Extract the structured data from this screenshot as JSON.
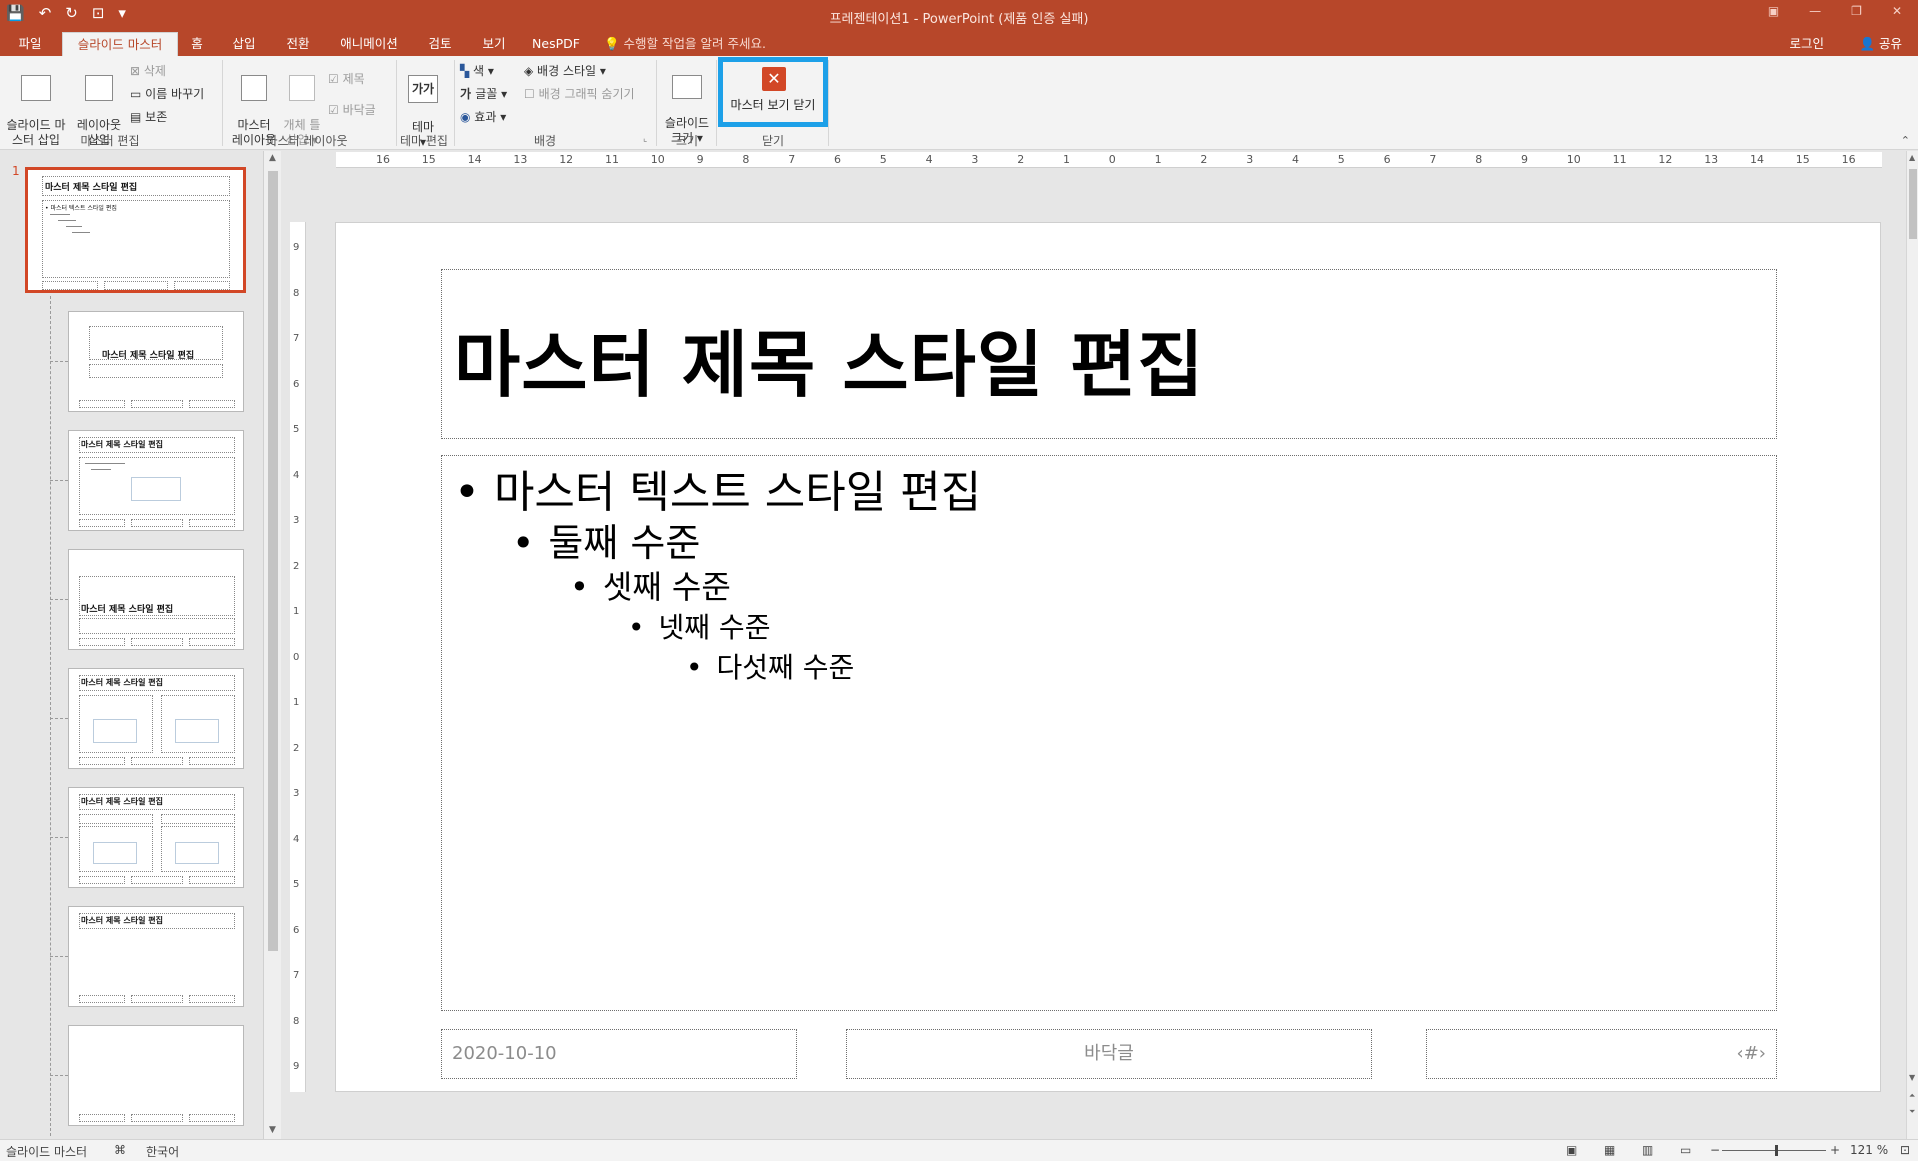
{
  "window": {
    "title": "프레젠테이션1 - PowerPoint (제품 인증 실패)"
  },
  "qat": {
    "save_icon": "💾",
    "undo_icon": "↶",
    "redo_icon": "↻",
    "present_icon": "⊡",
    "more_icon": "▾"
  },
  "window_controls": {
    "ribbon_opts": "▣",
    "minimize": "—",
    "restore": "❐",
    "close": "✕"
  },
  "tabs": [
    "파일",
    "슬라이드 마스터",
    "홈",
    "삽입",
    "전환",
    "애니메이션",
    "검토",
    "보기",
    "NesPDF"
  ],
  "tell_me": "수행할 작업을 알려 주세요.",
  "account": {
    "login": "로그인",
    "share": "공유"
  },
  "ribbon": {
    "insert_master": "슬라이드 마\n스터 삽입",
    "insert_layout": "레이아웃\n삽입",
    "delete": "삭제",
    "rename": "이름 바꾸기",
    "preserve": "보존",
    "group_master_edit": "마스터 편집",
    "master_layout": "마스터\n레이아웃",
    "insert_placeholder": "개체 틀\n삽입 ▾",
    "title_check": "제목",
    "footer_check": "바닥글",
    "group_master_layout": "마스터 레이아웃",
    "theme_icon_text": "가가",
    "themes": "테마\n▾",
    "group_theme_edit": "테마 편집",
    "colors": "색 ▾",
    "fonts": "글꼴 ▾",
    "effects": "효과 ▾",
    "bg_styles": "배경 스타일 ▾",
    "hide_bg_graphics": "배경 그래픽 숨기기",
    "group_background": "배경",
    "slide_size": "슬라이드\n크기 ▾",
    "group_size": "크기",
    "close_master": "마스터 보기 닫기",
    "group_close": "닫기",
    "close_icon": "✕",
    "collapse_icon": "⌃"
  },
  "thumbnails": {
    "slide_number": "1",
    "master_title": "마스터 제목 스타일 편집",
    "layout_title": "마스터 제목 스타일 편집",
    "master_body": "• 마스터 텍스트 스타일 편집"
  },
  "slide": {
    "title": "마스터 제목 스타일 편집",
    "levels": [
      "마스터 텍스트 스타일 편집",
      "둘째 수준",
      "셋째 수준",
      "넷째 수준",
      "다섯째 수준"
    ],
    "bullet": "•",
    "date": "2020-10-10",
    "footer": "바닥글",
    "page_number": "‹#›"
  },
  "ruler": {
    "horizontal": [
      "16",
      "15",
      "14",
      "13",
      "12",
      "11",
      "10",
      "9",
      "8",
      "7",
      "6",
      "5",
      "4",
      "3",
      "2",
      "1",
      "0",
      "1",
      "2",
      "3",
      "4",
      "5",
      "6",
      "7",
      "8",
      "9",
      "10",
      "11",
      "12",
      "13",
      "14",
      "15",
      "16"
    ],
    "vertical": [
      "9",
      "8",
      "7",
      "6",
      "5",
      "4",
      "3",
      "2",
      "1",
      "0",
      "1",
      "2",
      "3",
      "4",
      "5",
      "6",
      "7",
      "8",
      "9"
    ]
  },
  "statusbar": {
    "view": "슬라이드 마스터",
    "lang": "한국어",
    "zoom": "121 %",
    "zoom_level_pct": 121,
    "minus": "−",
    "plus": "+"
  }
}
